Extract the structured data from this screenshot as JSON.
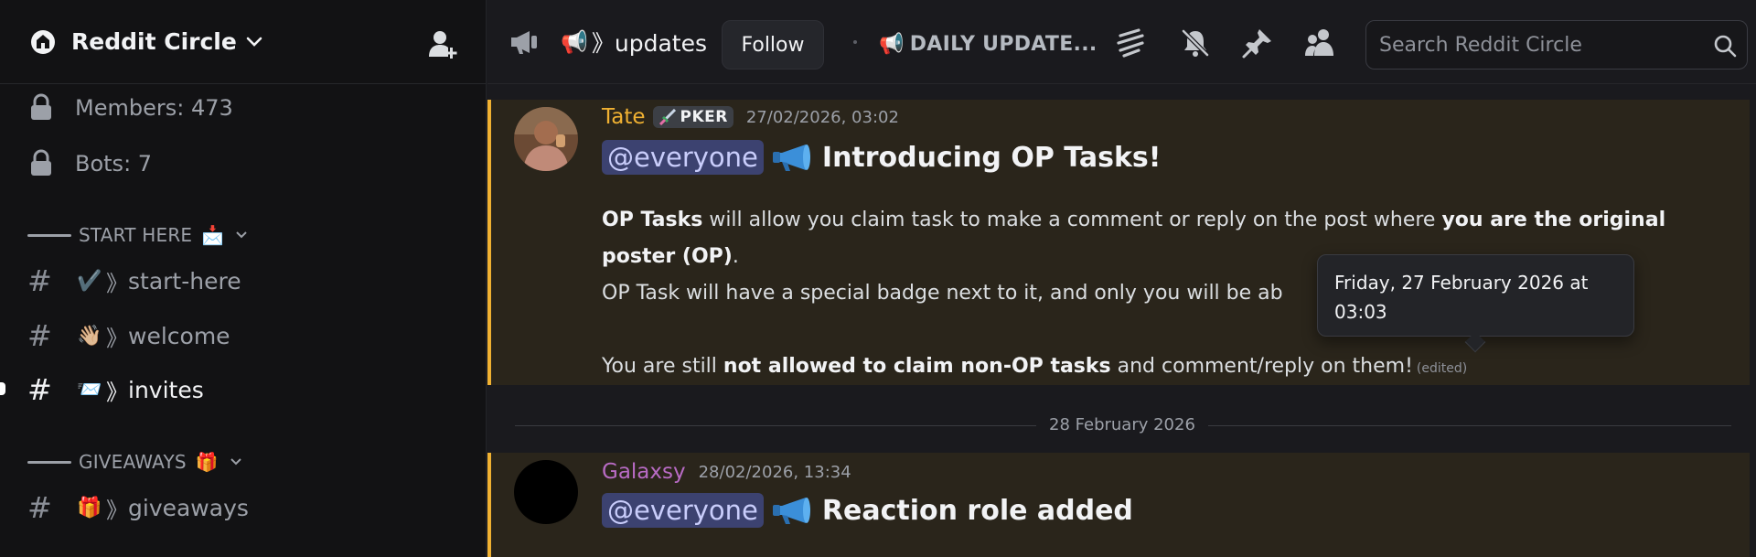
{
  "server": {
    "name": "Reddit Circle",
    "stats": [
      {
        "label": "Members: 473"
      },
      {
        "label": "Bots: 7"
      }
    ]
  },
  "sidebar": {
    "categories": [
      {
        "label": "START HERE",
        "emoji": "📩"
      },
      {
        "label": "GIVEAWAYS",
        "emoji": "🎁"
      }
    ],
    "channels": [
      {
        "emoji": "✔️",
        "sep": "》",
        "name": "start-here"
      },
      {
        "emoji": "👋🏼",
        "sep": "》",
        "name": "welcome"
      },
      {
        "emoji": "📨",
        "sep": "》",
        "name": "invites"
      },
      {
        "emoji": "🎁",
        "sep": "》",
        "name": "giveaways"
      }
    ]
  },
  "topbar": {
    "channel_emoji": "📢",
    "channel_name": "》updates",
    "follow_label": "Follow",
    "topic_emoji": "📢",
    "topic": "DAILY UPDATE...",
    "search_placeholder": "Search Reddit Circle",
    "icons": [
      "threads-icon",
      "mute-bell-icon",
      "pin-icon",
      "members-icon"
    ]
  },
  "messages": [
    {
      "author": "Tate",
      "author_color": "#f0b132",
      "role": "PKER",
      "timestamp": "27/02/2026, 03:02",
      "mention": "@everyone",
      "headline": "Introducing OP Tasks!",
      "line1_bold": "OP Tasks",
      "line1_text": " will allow you claim task to make a comment or reply on the post where ",
      "line1_bold2": "you are the original poster (OP)",
      "line1_end": ".",
      "line2": "OP Task will have a special badge next to it, and only you will be ab",
      "line3_pre": "You are still ",
      "line3_bold": "not allowed to claim non-OP tasks",
      "line3_post": " and comment/reply on them!",
      "edited": "(edited)"
    },
    {
      "author": "Galaxsy",
      "author_color": "#b86bc4",
      "timestamp": "28/02/2026, 13:34",
      "mention": "@everyone",
      "headline": "Reaction role added"
    }
  ],
  "date_divider": "28 February 2026",
  "tooltip": {
    "line1": "Friday, 27 February 2026 at",
    "line2": "03:03"
  },
  "colors": {
    "accent_bar": "#f0b132",
    "highlight_bg": "#2a251b",
    "mention_bg": "#3c4270"
  }
}
